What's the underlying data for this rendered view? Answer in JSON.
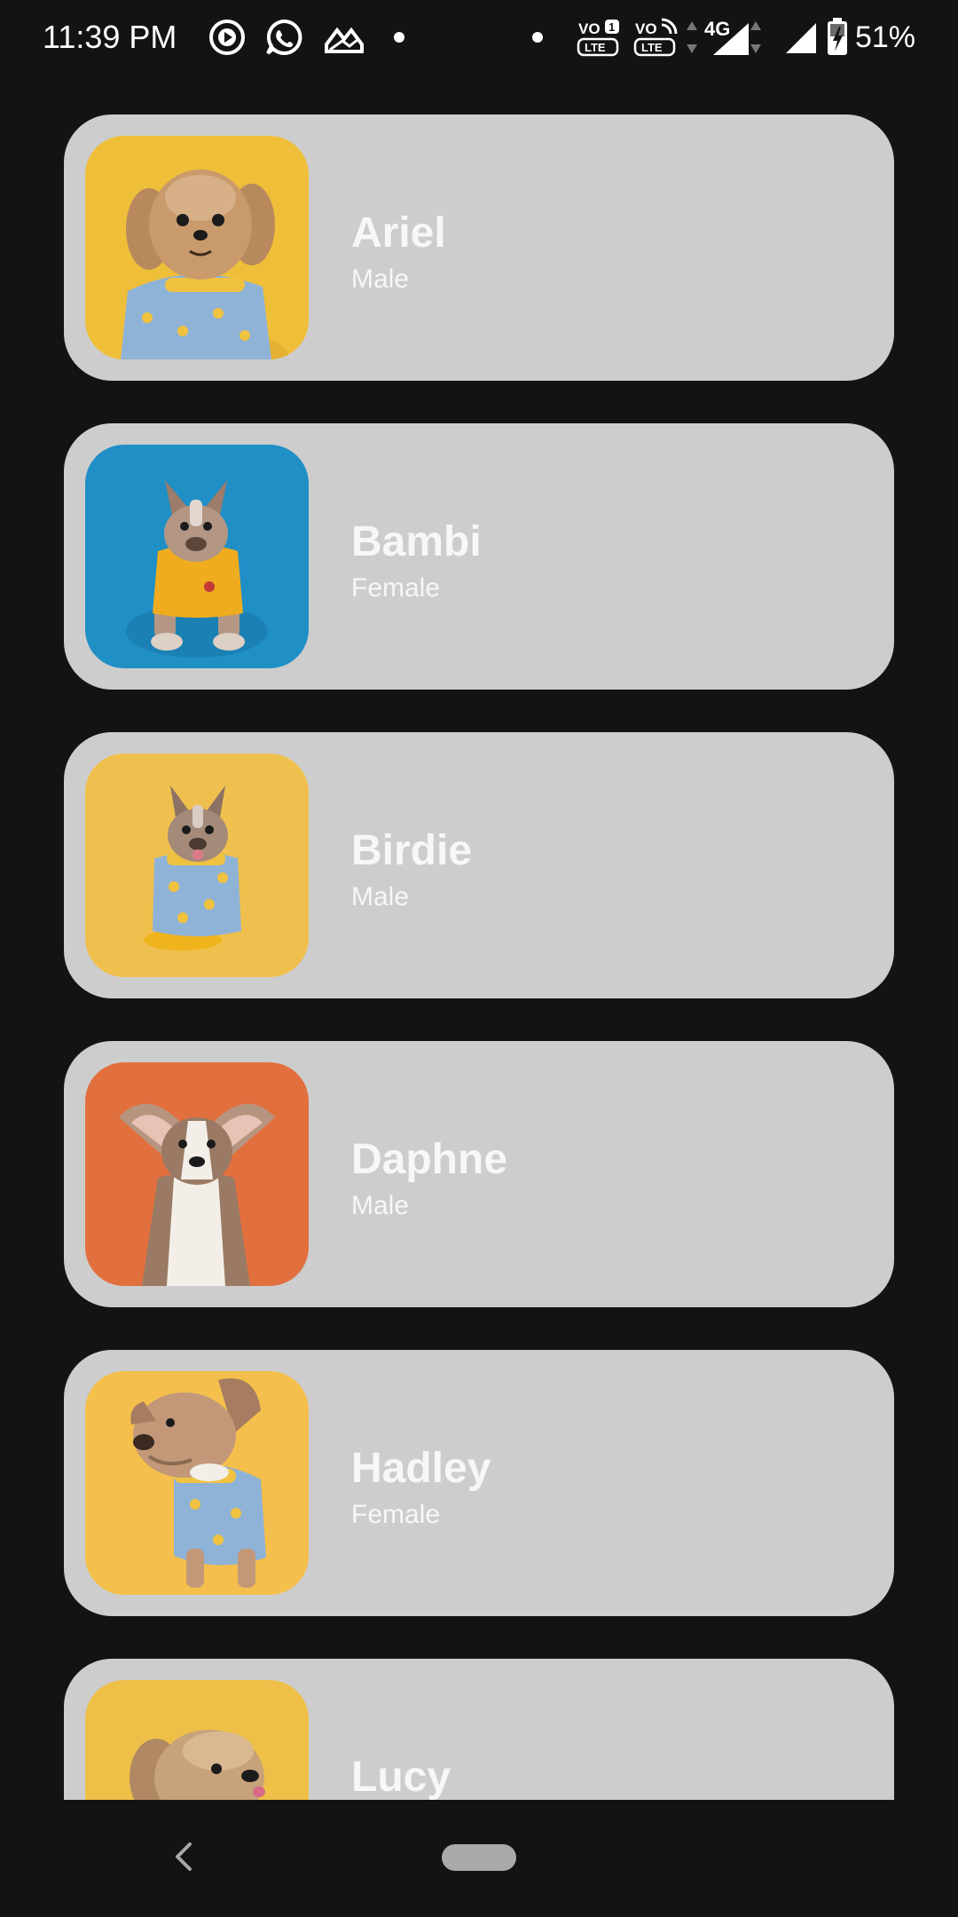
{
  "status_bar": {
    "time": "11:39 PM",
    "battery_percent": "51%",
    "left_icons": [
      "play-icon",
      "whatsapp-icon",
      "gallery-icon",
      "dot-icon"
    ],
    "right_icons": [
      "dot-icon",
      "volte-1-icon",
      "volte-2-icon",
      "4g-icon",
      "signal-1-icon",
      "signal-2-icon",
      "battery-charging-icon"
    ]
  },
  "pets": [
    {
      "name": "Ariel",
      "sex": "Male",
      "bg_color": "#efbf3a",
      "coat_color": "#c99a6b",
      "shirt_color": "#8fb3d6"
    },
    {
      "name": "Bambi",
      "sex": "Female",
      "bg_color": "#1f8fc6",
      "coat_color": "#b39784",
      "shirt_color": "#efac1e"
    },
    {
      "name": "Birdie",
      "sex": "Male",
      "bg_color": "#f0c04e",
      "coat_color": "#a58a7a",
      "shirt_color": "#8fb3d6"
    },
    {
      "name": "Daphne",
      "sex": "Male",
      "bg_color": "#e2703f",
      "coat_color": "#9a7a64",
      "shirt_color": "#f3efe8"
    },
    {
      "name": "Hadley",
      "sex": "Female",
      "bg_color": "#f4bf4c",
      "coat_color": "#c29879",
      "shirt_color": "#8fb3d6"
    },
    {
      "name": "Lucy",
      "sex": "",
      "bg_color": "#eec048",
      "coat_color": "#c7a27a",
      "shirt_color": "#c7a27a"
    }
  ],
  "colors": {
    "screen_bg": "#131313",
    "card_bg": "#cdcdcd",
    "card_text": "#f7f7f7",
    "nav_pill": "#a9a9a9"
  },
  "nav_bar": {
    "buttons": [
      "back-icon",
      "home-pill"
    ]
  }
}
